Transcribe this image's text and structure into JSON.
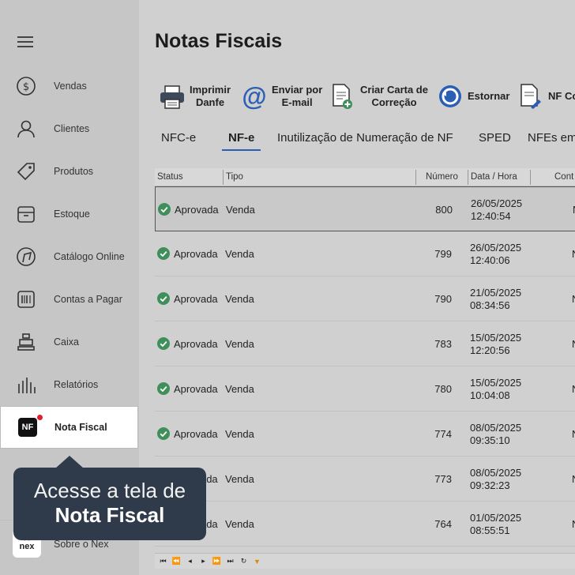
{
  "sidebar": {
    "items": [
      {
        "label": "Vendas",
        "icon": "dollar-icon"
      },
      {
        "label": "Clientes",
        "icon": "person-icon"
      },
      {
        "label": "Produtos",
        "icon": "tag-icon"
      },
      {
        "label": "Estoque",
        "icon": "box-icon"
      },
      {
        "label": "Catálogo Online",
        "icon": "catalog-icon"
      },
      {
        "label": "Contas a Pagar",
        "icon": "barcode-icon"
      },
      {
        "label": "Caixa",
        "icon": "register-icon"
      },
      {
        "label": "Relatórios",
        "icon": "bars-icon"
      },
      {
        "label": "Nota Fiscal",
        "icon": "nf-icon",
        "badge": "NF"
      }
    ],
    "about": {
      "label": "Sobre o Nex",
      "logo_text": "nex"
    }
  },
  "main": {
    "title": "Notas Fiscais",
    "toolbar": [
      {
        "label_line1": "Imprimir",
        "label_line2": "Danfe",
        "icon": "printer-icon"
      },
      {
        "label_line1": "Enviar por",
        "label_line2": "E-mail",
        "icon": "at-icon"
      },
      {
        "label_line1": "Criar Carta de",
        "label_line2": "Correção",
        "icon": "document-add-icon"
      },
      {
        "label_line1": "Estornar",
        "label_line2": "",
        "icon": "undo-icon"
      },
      {
        "label_line1": "NF Co",
        "label_line2": "",
        "icon": "document-pin-icon"
      }
    ],
    "tabs": [
      {
        "label": "NFC-e"
      },
      {
        "label": "NF-e",
        "active": true
      },
      {
        "label": "Inutilização de Numeração de NF"
      },
      {
        "label": "SPED"
      },
      {
        "label": "NFEs em"
      }
    ],
    "grid": {
      "headers": [
        "Status",
        "Tipo",
        "Número",
        "Data / Hora",
        "Cont"
      ],
      "rows": [
        {
          "status": "Aprovada",
          "tipo": "Venda",
          "numero": "800",
          "data": "26/05/2025",
          "hora": "12:40:54",
          "cont": "N"
        },
        {
          "status": "Aprovada",
          "tipo": "Venda",
          "numero": "799",
          "data": "26/05/2025",
          "hora": "12:40:06",
          "cont": "N"
        },
        {
          "status": "Aprovada",
          "tipo": "Venda",
          "numero": "790",
          "data": "21/05/2025",
          "hora": "08:34:56",
          "cont": "N"
        },
        {
          "status": "Aprovada",
          "tipo": "Venda",
          "numero": "783",
          "data": "15/05/2025",
          "hora": "12:20:56",
          "cont": "N"
        },
        {
          "status": "Aprovada",
          "tipo": "Venda",
          "numero": "780",
          "data": "15/05/2025",
          "hora": "10:04:08",
          "cont": "N"
        },
        {
          "status": "Aprovada",
          "tipo": "Venda",
          "numero": "774",
          "data": "08/05/2025",
          "hora": "09:35:10",
          "cont": "N"
        },
        {
          "status": "Aprovada",
          "tipo": "Venda",
          "numero": "773",
          "data": "08/05/2025",
          "hora": "09:32:23",
          "cont": "N"
        },
        {
          "status": "Aprovada",
          "tipo": "Venda",
          "numero": "764",
          "data": "01/05/2025",
          "hora": "08:55:51",
          "cont": "N"
        }
      ]
    }
  },
  "tooltip": {
    "line1": "Acesse a tela de",
    "line2": "Nota Fiscal"
  },
  "colors": {
    "accent": "#2a5fb4",
    "tooltip_bg": "#2f3b4b",
    "status_ok": "#3f8f5a",
    "badge_red": "#e51d2a"
  }
}
